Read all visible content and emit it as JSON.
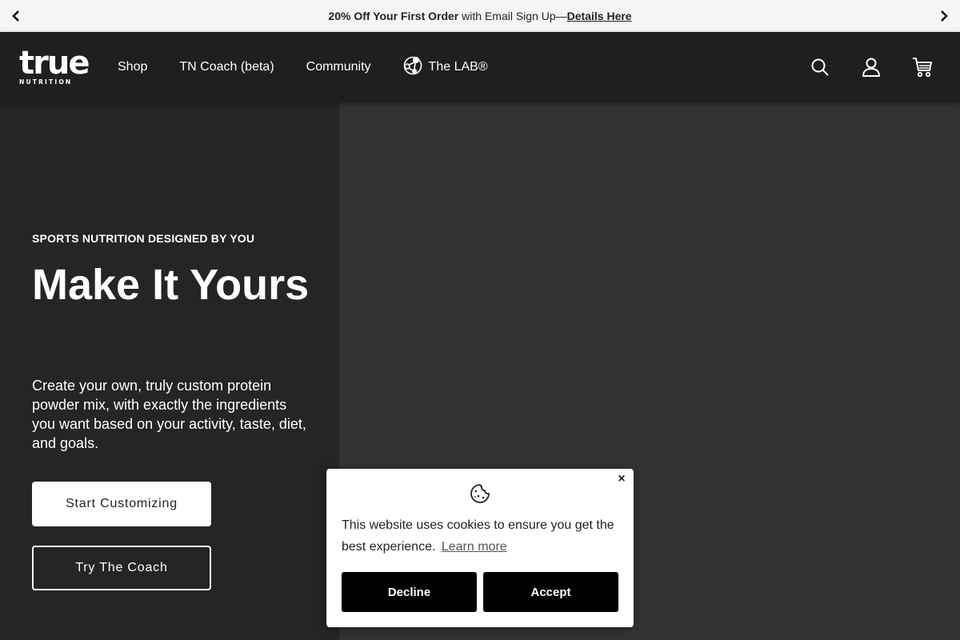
{
  "announcement": {
    "bold_text": "20% Off Your First Order",
    "text": " with Email Sign Up—",
    "link": "Details Here",
    "prev_icon": "chevron-left-icon",
    "next_icon": "chevron-right-icon"
  },
  "header": {
    "logo_word": "true",
    "logo_sub": "NUTRITION",
    "nav": [
      {
        "label": "Shop"
      },
      {
        "label": "TN Coach (beta)"
      },
      {
        "label": "Community"
      },
      {
        "label": "The LAB®",
        "icon": "molecule-icon"
      }
    ],
    "icons": [
      "search-icon",
      "account-icon",
      "cart-icon"
    ]
  },
  "hero": {
    "eyebrow": "SPORTS NUTRITION DESIGNED BY YOU",
    "headline": "Make It Yours",
    "description": "Create your own, truly custom protein powder mix, with exactly the ingredients you want based on your activity, taste, diet, and goals.",
    "primary_button": "Start Customizing",
    "secondary_button": "Try The Coach"
  },
  "cookie_banner": {
    "icon": "cookie-icon",
    "message": "This website uses cookies to ensure you get the best experience.",
    "learn_more": "Learn more",
    "decline": "Decline",
    "accept": "Accept",
    "close": "×"
  },
  "colors": {
    "header_bg": "#1f1f1f",
    "hero_left_bg": "#252525",
    "hero_right_bg": "#333333",
    "announcement_bg": "#f5f5f5",
    "cookie_button_bg": "#000000"
  }
}
